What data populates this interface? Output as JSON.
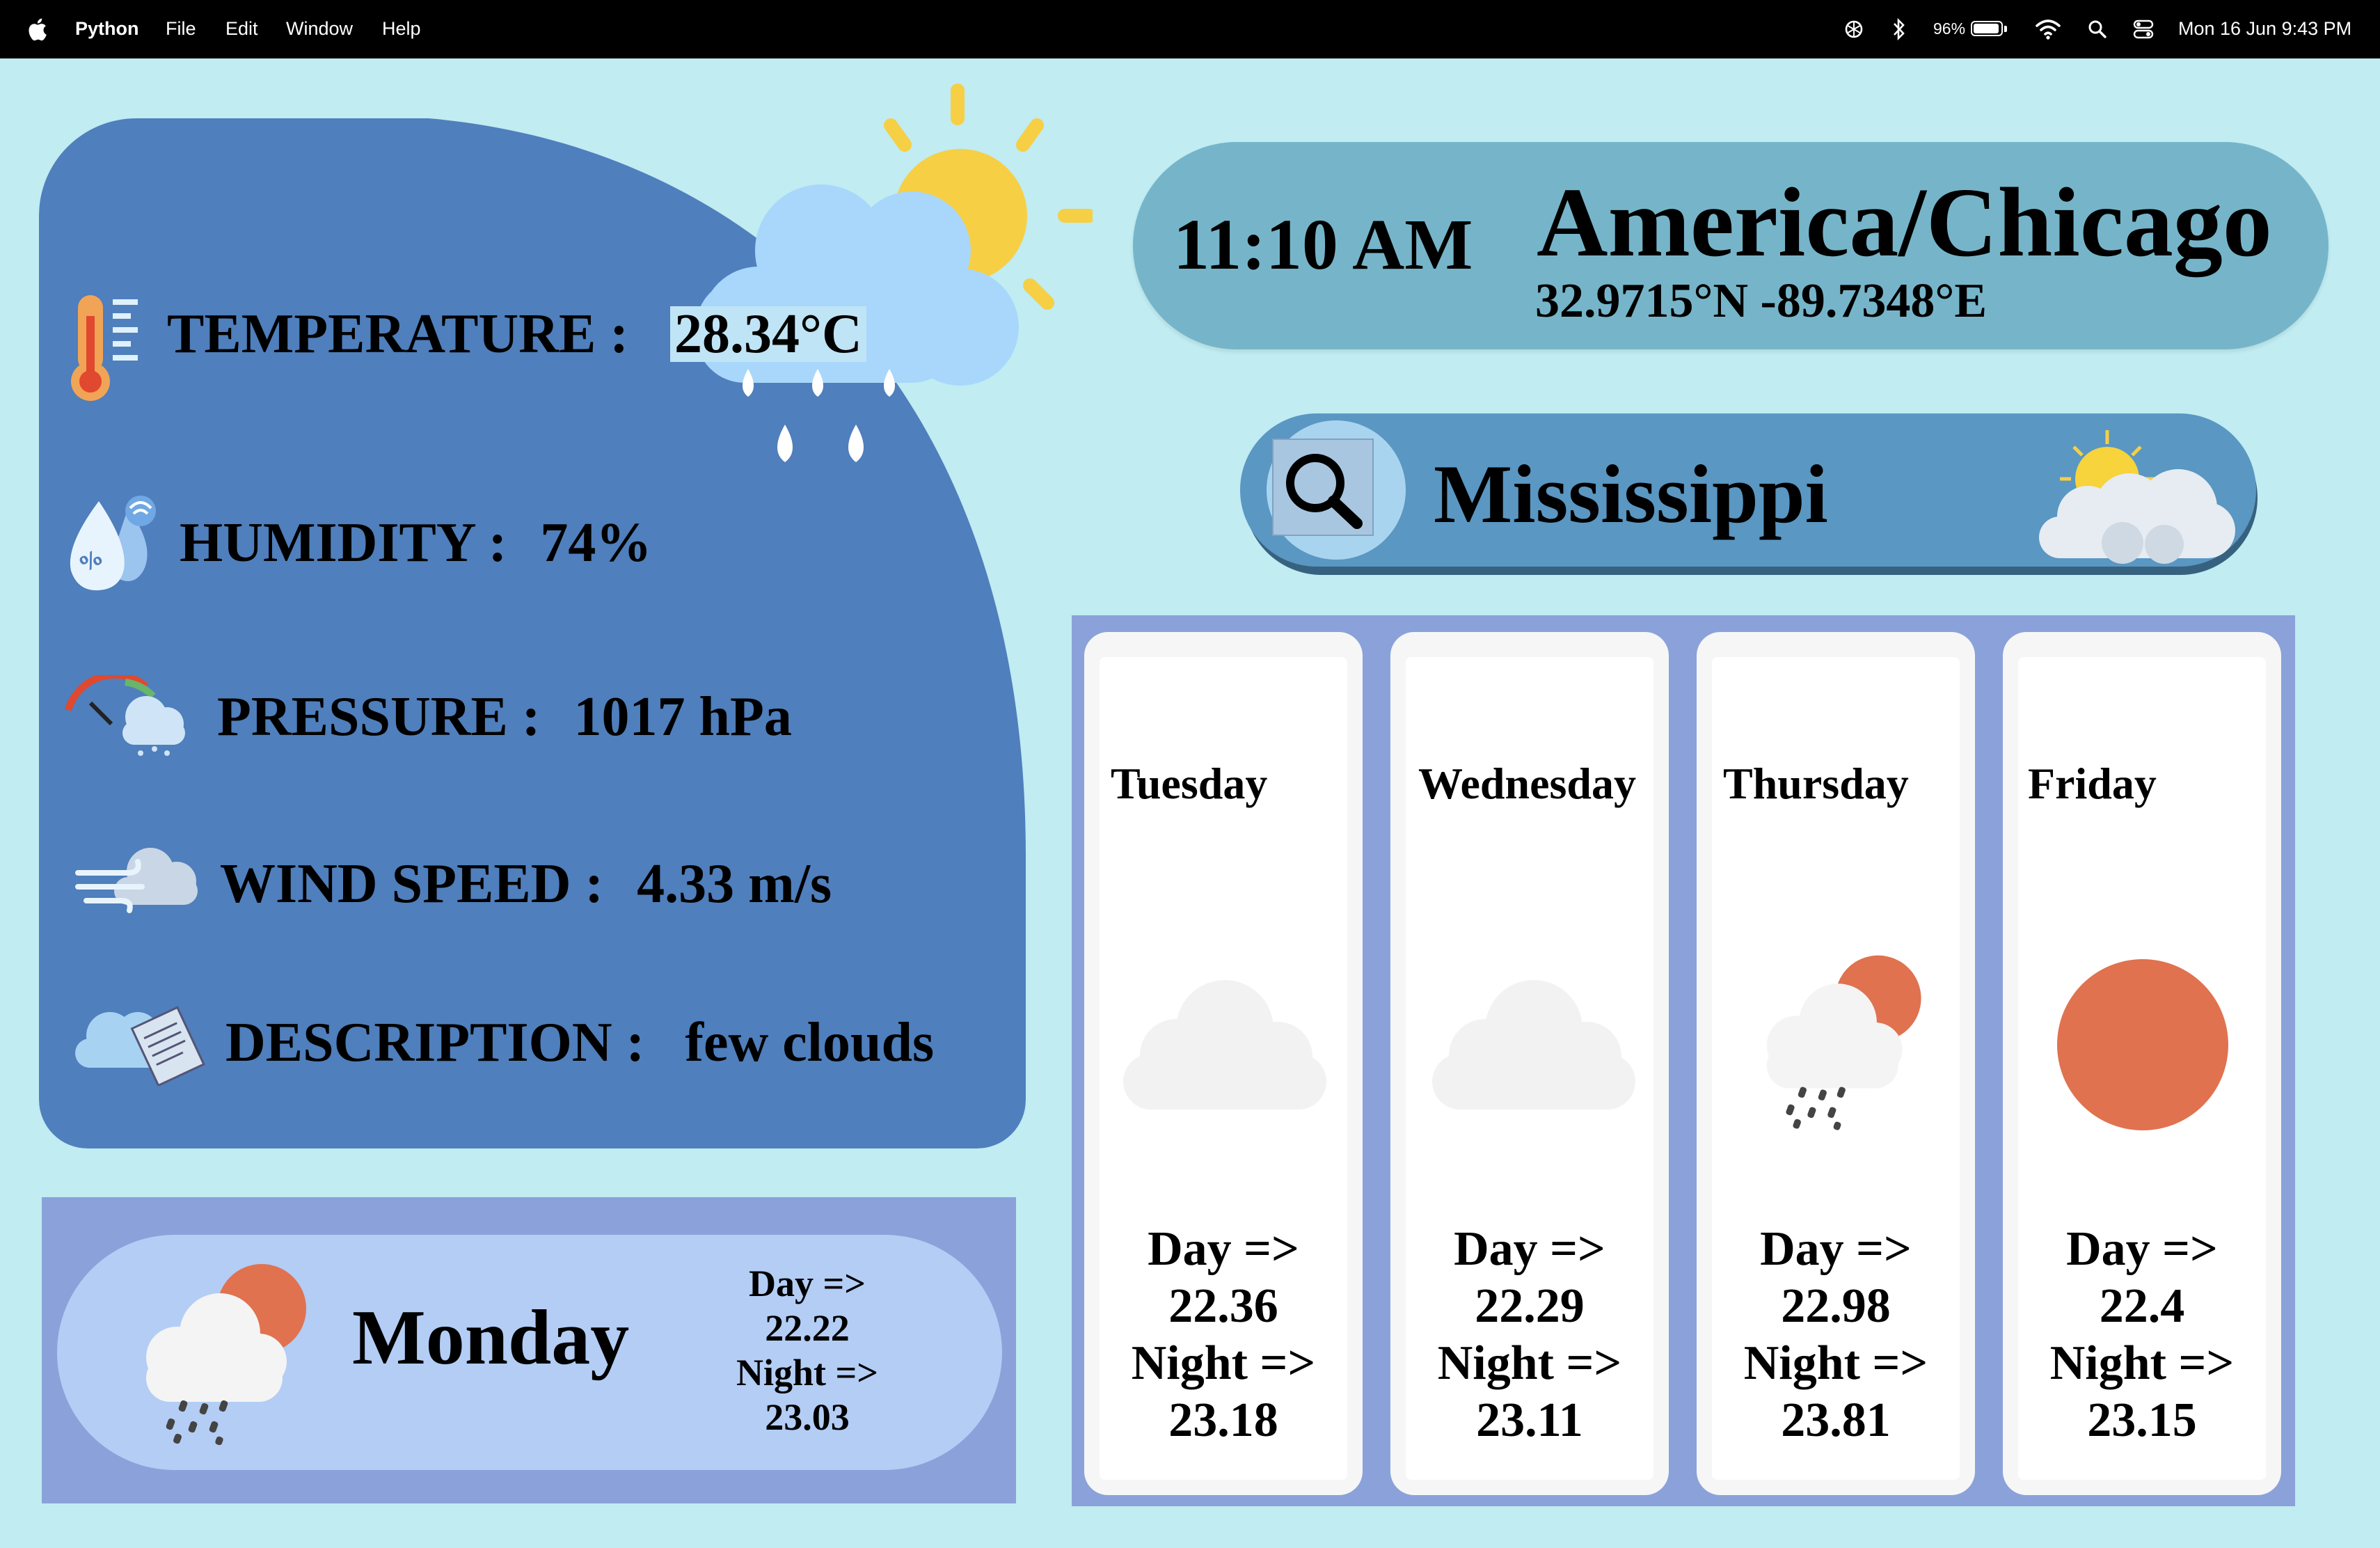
{
  "menubar": {
    "app": "Python",
    "menus": [
      "File",
      "Edit",
      "Window",
      "Help"
    ],
    "battery": "96%",
    "battery_level": 0.96,
    "datetime": "Mon 16 Jun  9:43 PM"
  },
  "details": {
    "temperature": {
      "label": "TEMPERATURE :",
      "value": "28.34°C"
    },
    "humidity": {
      "label": "HUMIDITY :",
      "value": "74%"
    },
    "pressure": {
      "label": "PRESSURE :",
      "value": "1017 hPa"
    },
    "wind": {
      "label": "WIND SPEED :",
      "value": "4.33 m/s"
    },
    "description": {
      "label": "DESCRIPTION :",
      "value": "few clouds"
    }
  },
  "location": {
    "time": "11:10 AM",
    "timezone": "America/Chicago",
    "coords": "32.9715°N -89.7348°E"
  },
  "search": {
    "value": "Mississippi"
  },
  "today": {
    "day": "Monday",
    "day_label": "Day =>",
    "day_temp": "22.22",
    "night_label": "Night =>",
    "night_temp": "23.03",
    "icon": "cloud-sun-rain-icon"
  },
  "forecast": [
    {
      "day": "Tuesday",
      "day_label": "Day =>",
      "day_temp": "22.36",
      "night_label": "Night =>",
      "night_temp": "23.18",
      "icon": "cloud-icon"
    },
    {
      "day": "Wednesday",
      "day_label": "Day =>",
      "day_temp": "22.29",
      "night_label": "Night =>",
      "night_temp": "23.11",
      "icon": "cloud-icon"
    },
    {
      "day": "Thursday",
      "day_label": "Day =>",
      "day_temp": "22.98",
      "night_label": "Night =>",
      "night_temp": "23.81",
      "icon": "cloud-sun-rain-icon"
    },
    {
      "day": "Friday",
      "day_label": "Day =>",
      "day_temp": "22.4",
      "night_label": "Night =>",
      "night_temp": "23.15",
      "icon": "sun-icon"
    }
  ],
  "colors": {
    "background": "#c0ecf2",
    "details_panel": "#4f7fbc",
    "location_pill": "#76b5c9",
    "search_bar": "#5a97c2",
    "card_frame": "#8aa2d9",
    "monday_pill": "#b3cdf5",
    "sun_orange": "#e07250",
    "sun_yellow": "#f6cf45"
  }
}
